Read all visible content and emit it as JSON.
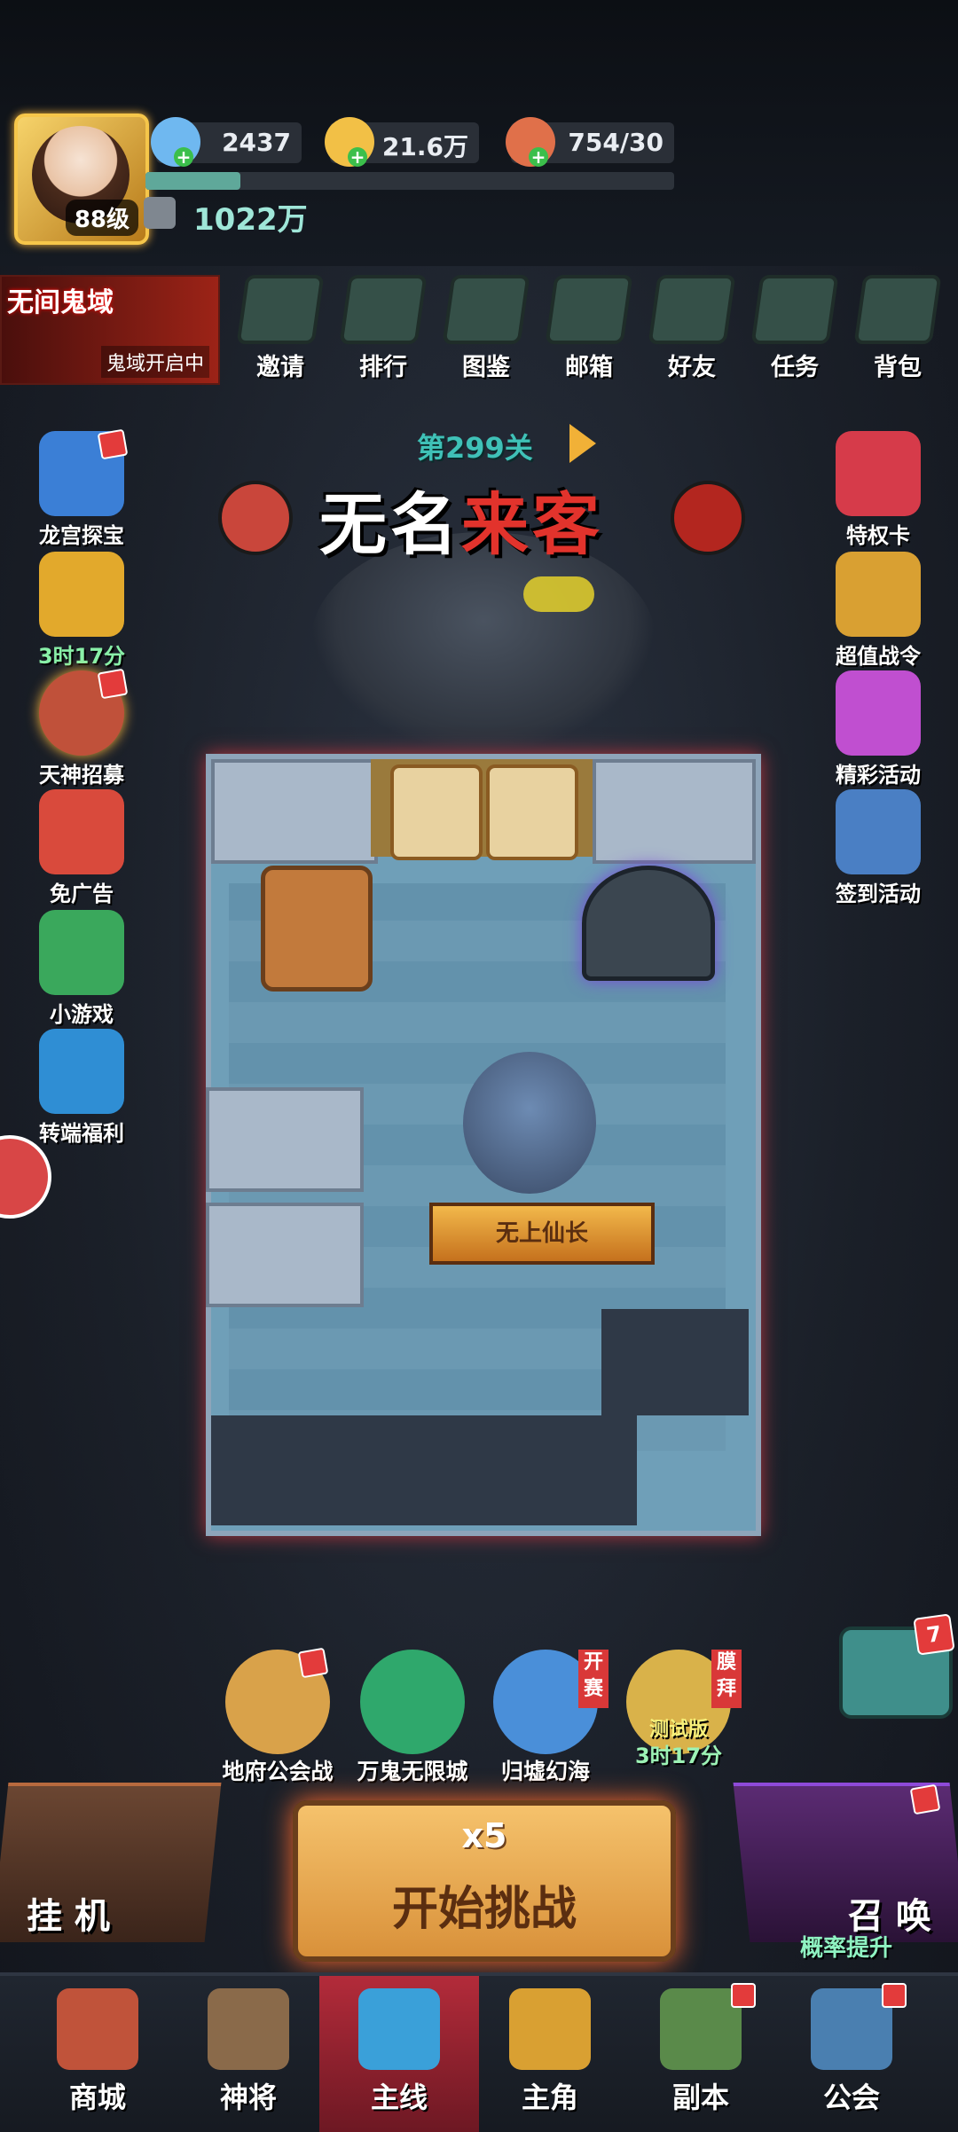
{
  "player": {
    "level": "88级",
    "power": "1022万",
    "exp_fraction": 0.18
  },
  "resources": [
    {
      "name": "gem",
      "value": "2437",
      "color": "#6fb8f0"
    },
    {
      "name": "gold",
      "value": "21.6万",
      "color": "#f2c046"
    },
    {
      "name": "stamina",
      "value": "754/30",
      "color": "#e0704a"
    }
  ],
  "event_banner": {
    "title": "无间鬼域",
    "subtitle": "鬼域开启中"
  },
  "top_nav": [
    {
      "label": "邀请",
      "icon": "invite-icon"
    },
    {
      "label": "排行",
      "icon": "ranking-icon"
    },
    {
      "label": "图鉴",
      "icon": "codex-icon"
    },
    {
      "label": "邮箱",
      "icon": "mail-icon"
    },
    {
      "label": "好友",
      "icon": "friends-icon"
    },
    {
      "label": "任务",
      "icon": "tasks-icon"
    },
    {
      "label": "背包",
      "icon": "backpack-icon"
    }
  ],
  "left_side": [
    {
      "label": "龙宫探宝",
      "icon": "dragon-palace-icon",
      "color": "#3b7fd6",
      "badge": true
    },
    {
      "label": "3时17分",
      "icon": "golden-fish-icon",
      "color": "#e2a92c",
      "timer": true
    },
    {
      "label": "天神招募",
      "icon": "god-recruit-icon",
      "color": "#c0513a",
      "badge": true
    },
    {
      "label": "免广告",
      "icon": "no-ads-icon",
      "color": "#d94a3c"
    },
    {
      "label": "小游戏",
      "icon": "minigame-icon",
      "color": "#3aa85c"
    },
    {
      "label": "转端福利",
      "icon": "transfer-bonus-icon",
      "color": "#2f8ed4"
    }
  ],
  "right_side": [
    {
      "label": "特权卡",
      "icon": "privilege-card-icon",
      "color": "#d63b4a"
    },
    {
      "label": "超值战令",
      "icon": "battle-pass-icon",
      "color": "#d9a032"
    },
    {
      "label": "精彩活动",
      "icon": "events-icon",
      "color": "#c04fd0"
    },
    {
      "label": "签到活动",
      "icon": "checkin-icon",
      "color": "#4a7fc4"
    }
  ],
  "stage": {
    "level": "第299关",
    "title_white": "无名",
    "title_red": "来客"
  },
  "board": {
    "hero_title": "无上仙长"
  },
  "modes": [
    {
      "label": "地府公会战",
      "icon": "underworld-guild-war-icon",
      "color": "#d9a24a"
    },
    {
      "label": "万鬼无限城",
      "icon": "ghost-castle-icon",
      "color": "#2fa86c"
    },
    {
      "label": "归墟幻海",
      "icon": "abyss-sea-icon",
      "color": "#4a8fd9",
      "tag": "开赛"
    },
    {
      "label": "3时17分",
      "icon": "worship-icon",
      "color": "#d9b24a",
      "tag": "膜拜",
      "test": "测试版"
    }
  ],
  "chat": {
    "count": "7"
  },
  "idle": {
    "label": "挂 机"
  },
  "start": {
    "cost": "x5",
    "label": "开始挑战"
  },
  "summon": {
    "label": "召 唤",
    "sub": "概率提升"
  },
  "tabs": [
    {
      "label": "商城",
      "icon": "shop-icon",
      "color": "#c0533a"
    },
    {
      "label": "神将",
      "icon": "generals-icon",
      "color": "#8a6a4a"
    },
    {
      "label": "主线",
      "icon": "main-quest-icon",
      "color": "#3aa0d9",
      "active": true
    },
    {
      "label": "主角",
      "icon": "protagonist-icon",
      "color": "#d9a032"
    },
    {
      "label": "副本",
      "icon": "dungeon-icon",
      "color": "#5a8a4a",
      "badge": true
    },
    {
      "label": "公会",
      "icon": "guild-icon",
      "color": "#4a7fb0",
      "badge": true
    }
  ]
}
